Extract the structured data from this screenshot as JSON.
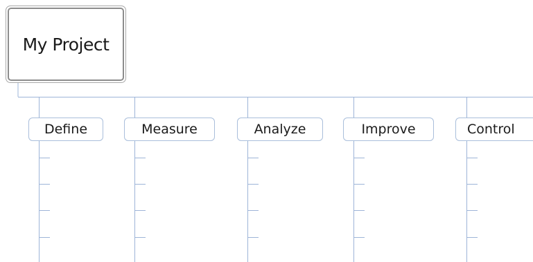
{
  "map": {
    "central_topic": "My Project",
    "topics": [
      {
        "label": "Define"
      },
      {
        "label": "Measure"
      },
      {
        "label": "Analyze"
      },
      {
        "label": "Improve"
      },
      {
        "label": "Control"
      }
    ],
    "subtopics_per_topic": 4,
    "colors": {
      "connector": "#9db4d8",
      "topic_border": "#a9bedb",
      "root_border": "#8c8c8c",
      "text": "#1a1a1a",
      "background": "#ffffff"
    }
  }
}
